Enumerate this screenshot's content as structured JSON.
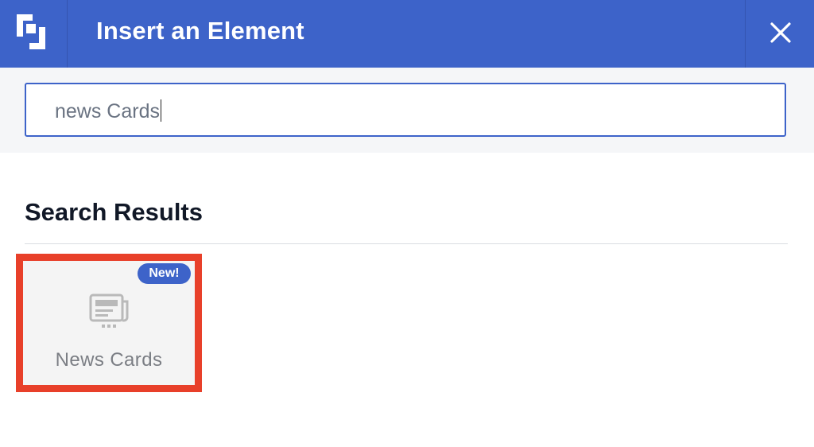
{
  "header": {
    "logo_icon": "brand-logo-icon",
    "title": "Insert an Element",
    "close_icon": "close-icon"
  },
  "search": {
    "value": "news Cards"
  },
  "results": {
    "heading": "Search Results",
    "items": [
      {
        "label": "News Cards",
        "badge": "New!",
        "icon": "news-icon",
        "highlighted": true
      }
    ]
  },
  "colors": {
    "header_bg": "#3d63c9",
    "accent": "#3d63c9",
    "highlight": "#e8402a",
    "card_bg": "#f4f4f4"
  }
}
